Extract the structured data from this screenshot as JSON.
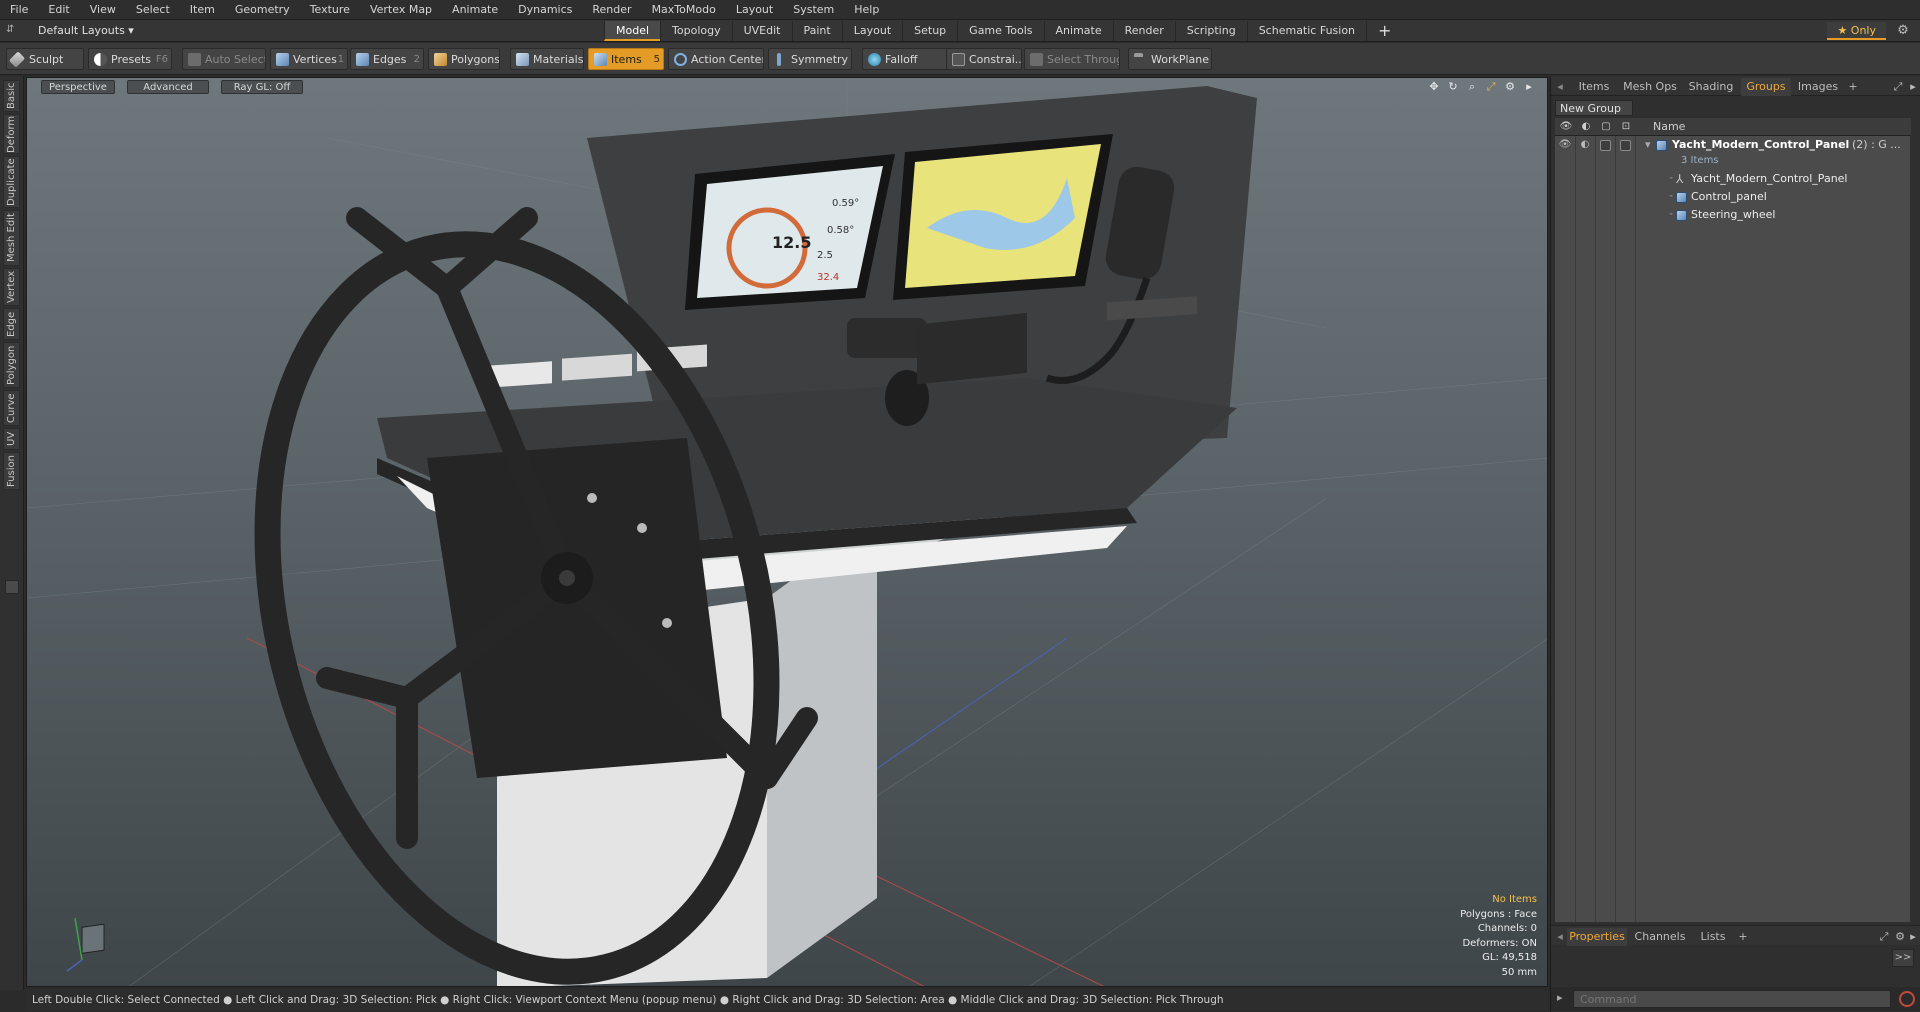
{
  "menubar": {
    "items": [
      "File",
      "Edit",
      "View",
      "Select",
      "Item",
      "Geometry",
      "Texture",
      "Vertex Map",
      "Animate",
      "Dynamics",
      "Render",
      "MaxToModo",
      "Layout",
      "System",
      "Help"
    ]
  },
  "layoutbar": {
    "layout_select": "Default Layouts ▾",
    "tabs": [
      "Model",
      "Topology",
      "UVEdit",
      "Paint",
      "Layout",
      "Setup",
      "Game Tools",
      "Animate",
      "Render",
      "Scripting",
      "Schematic Fusion"
    ],
    "active_tab": "Model",
    "add_tab": "+",
    "only_label": "★  Only"
  },
  "toolbar": {
    "sculpt": "Sculpt",
    "presets": "Presets",
    "presets_key": "F6",
    "auto_select": "Auto Select",
    "vertices": "Vertices",
    "vertices_key": "1",
    "edges": "Edges",
    "edges_key": "2",
    "polygons": "Polygons",
    "materials": "Materials",
    "items": "Items",
    "items_key": "5",
    "action_center": "Action Center",
    "symmetry": "Symmetry",
    "falloff": "Falloff",
    "constraints": "Constrai...",
    "select_through": "Select Through",
    "workplane": "WorkPlane"
  },
  "left_tabs": [
    "Basic",
    "Deform",
    "Duplicate",
    "Mesh Edit",
    "Vertex",
    "Edge",
    "Polygon",
    "Curve",
    "UV",
    "Fusion"
  ],
  "viewport": {
    "view_mode": "Perspective",
    "advanced": "Advanced",
    "ray_gl": "Ray GL: Off",
    "info": {
      "selection": "No Items",
      "polygons": "Polygons : Face",
      "channels": "Channels: 0",
      "deformers": "Deformers: ON",
      "gl": "GL: 49,518",
      "focal": "50 mm"
    },
    "screen_readouts": [
      "0.59°",
      "0.58°",
      "12.5",
      "2.5",
      "32.4"
    ]
  },
  "statusbar": {
    "text": "Left Double Click: Select Connected ● Left Click and Drag: 3D Selection: Pick ● Right Click: Viewport Context Menu (popup menu) ● Right Click and Drag: 3D Selection: Area ● Middle Click and Drag: 3D Selection: Pick Through"
  },
  "rightpanel": {
    "tabs": [
      "Items",
      "Mesh Ops",
      "Shading",
      "Groups",
      "Images"
    ],
    "active_tab": "Groups",
    "add_tab": "+",
    "new_group": "New Group",
    "column_name": "Name",
    "group": {
      "name": "Yacht_Modern_Control_Panel",
      "suffix": "(2) : G ...",
      "count": "3 Items"
    },
    "children": [
      "Yacht_Modern_Control_Panel",
      "Control_panel",
      "Steering_wheel"
    ],
    "bottom_tabs": [
      "Properties",
      "Channels",
      "Lists"
    ],
    "bottom_active": "Properties",
    "bottom_add": "+",
    "expand": ">>",
    "command_placeholder": "Command"
  },
  "colors": {
    "accent": "#e49c26",
    "active_tab_text": "#f0a83a",
    "viewport_top": "#6e787c",
    "viewport_bottom": "#3f4649",
    "panel_bg": "#4b4b4b",
    "info_warn": "#f3c04a"
  }
}
